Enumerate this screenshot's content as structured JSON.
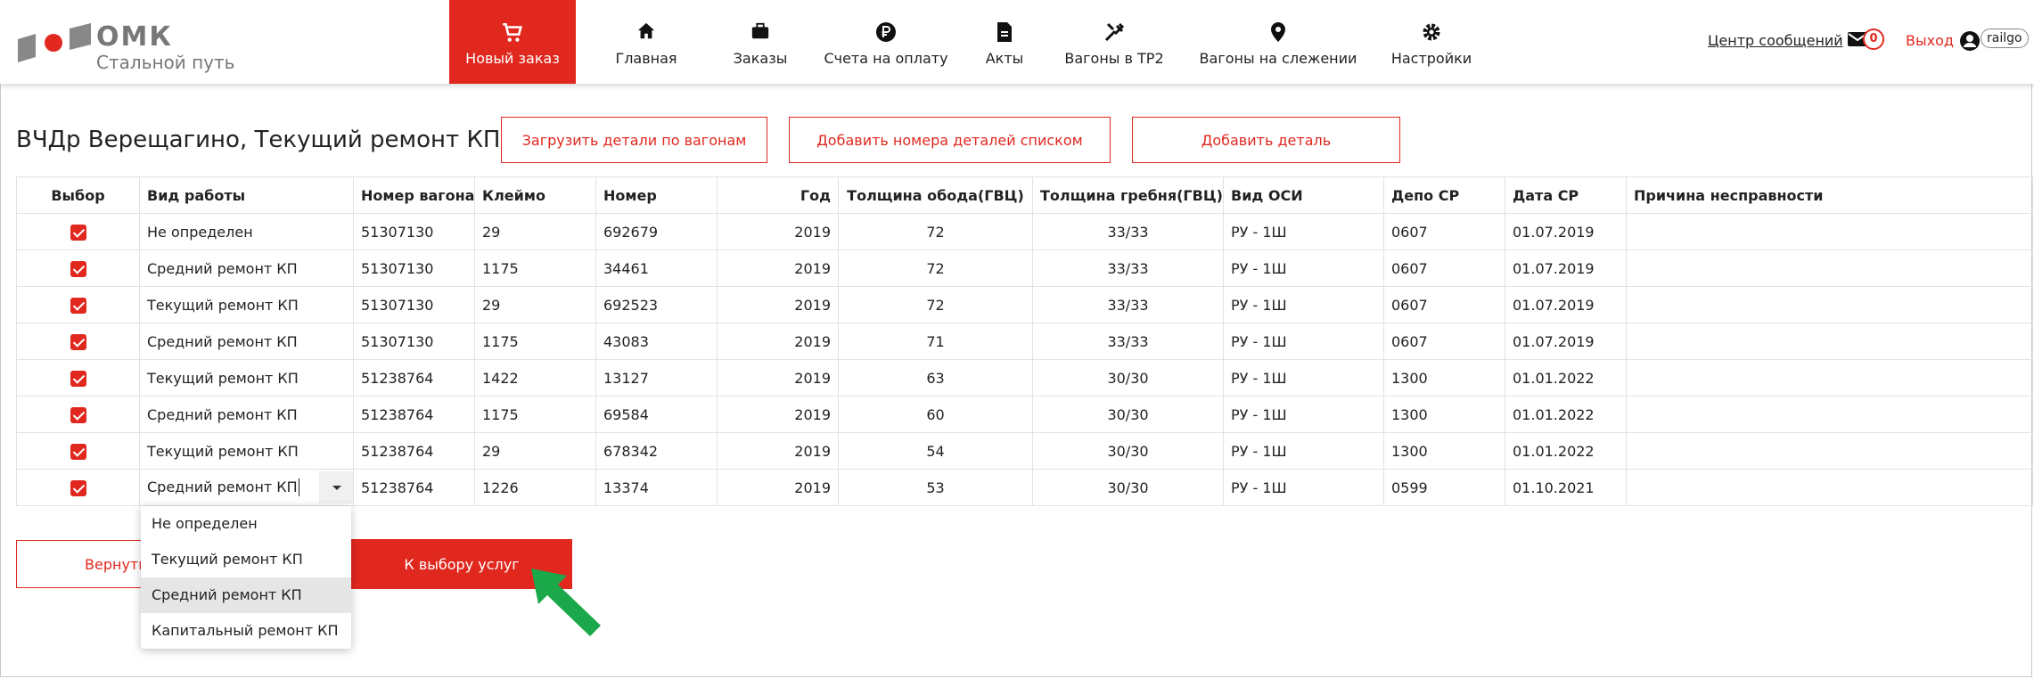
{
  "colors": {
    "accent": "#e0281e",
    "arrow": "#1aa84a"
  },
  "brand": {
    "name": "ОМК",
    "subtitle": "Стальной путь"
  },
  "nav": [
    {
      "label": "Новый заказ",
      "icon": "cart-icon",
      "active": true
    },
    {
      "label": "Главная",
      "icon": "home-icon"
    },
    {
      "label": "Заказы",
      "icon": "briefcase-icon"
    },
    {
      "label": "Счета на оплату",
      "icon": "ruble-icon"
    },
    {
      "label": "Акты",
      "icon": "document-icon"
    },
    {
      "label": "Вагоны в ТР2",
      "icon": "tools-icon"
    },
    {
      "label": "Вагоны на слежении",
      "icon": "map-pin-icon"
    },
    {
      "label": "Настройки",
      "icon": "gear-icon"
    }
  ],
  "header": {
    "messages_label": "Центр сообщений",
    "messages_count": "0",
    "logout_label": "Выход",
    "username": "railgo"
  },
  "page": {
    "title": "ВЧДр Верещагино, Текущий ремонт КП"
  },
  "actions": {
    "upload": "Загрузить детали по вагонам",
    "add_list": "Добавить номера деталей списком",
    "add_detail": "Добавить деталь"
  },
  "table": {
    "columns": [
      "Выбор",
      "Вид работы",
      "Номер вагона",
      "Клеймо",
      "Номер",
      "Год",
      "Толщина обода(ГВЦ)",
      "Толщина гребня(ГВЦ)",
      "Вид ОСИ",
      "Депо СР",
      "Дата СР",
      "Причина несправности"
    ],
    "rows": [
      {
        "work": "Не определен",
        "wagon": "51307130",
        "stamp": "29",
        "number": "692679",
        "year": "2019",
        "rim": "72",
        "flange": "33/33",
        "axle": "РУ - 1Ш",
        "depot": "0607",
        "date": "01.07.2019",
        "reason": ""
      },
      {
        "work": "Средний ремонт КП",
        "wagon": "51307130",
        "stamp": "1175",
        "number": "34461",
        "year": "2019",
        "rim": "72",
        "flange": "33/33",
        "axle": "РУ - 1Ш",
        "depot": "0607",
        "date": "01.07.2019",
        "reason": ""
      },
      {
        "work": "Текущий ремонт КП",
        "wagon": "51307130",
        "stamp": "29",
        "number": "692523",
        "year": "2019",
        "rim": "72",
        "flange": "33/33",
        "axle": "РУ - 1Ш",
        "depot": "0607",
        "date": "01.07.2019",
        "reason": ""
      },
      {
        "work": "Средний ремонт КП",
        "wagon": "51307130",
        "stamp": "1175",
        "number": "43083",
        "year": "2019",
        "rim": "71",
        "flange": "33/33",
        "axle": "РУ - 1Ш",
        "depot": "0607",
        "date": "01.07.2019",
        "reason": ""
      },
      {
        "work": "Текущий ремонт КП",
        "wagon": "51238764",
        "stamp": "1422",
        "number": "13127",
        "year": "2019",
        "rim": "63",
        "flange": "30/30",
        "axle": "РУ - 1Ш",
        "depot": "1300",
        "date": "01.01.2022",
        "reason": ""
      },
      {
        "work": "Средний ремонт КП",
        "wagon": "51238764",
        "stamp": "1175",
        "number": "69584",
        "year": "2019",
        "rim": "60",
        "flange": "30/30",
        "axle": "РУ - 1Ш",
        "depot": "1300",
        "date": "01.01.2022",
        "reason": ""
      },
      {
        "work": "Текущий ремонт КП",
        "wagon": "51238764",
        "stamp": "29",
        "number": "678342",
        "year": "2019",
        "rim": "54",
        "flange": "30/30",
        "axle": "РУ - 1Ш",
        "depot": "1300",
        "date": "01.01.2022",
        "reason": ""
      },
      {
        "work": "Средний ремонт КП",
        "wagon": "51238764",
        "stamp": "1226",
        "number": "13374",
        "year": "2019",
        "rim": "53",
        "flange": "30/30",
        "axle": "РУ - 1Ш",
        "depot": "0599",
        "date": "01.10.2021",
        "reason": ""
      }
    ]
  },
  "dropdown": {
    "options": [
      "Не определен",
      "Текущий ремонт КП",
      "Средний ремонт КП",
      "Капитальный ремонт КП"
    ],
    "highlighted": "Средний ремонт КП"
  },
  "footer": {
    "back_label": "Вернуть",
    "next_label": "К выбору услуг"
  }
}
